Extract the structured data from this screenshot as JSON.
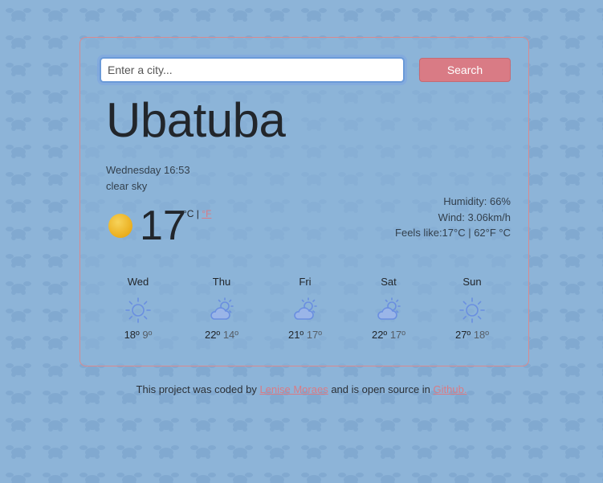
{
  "search": {
    "placeholder": "Enter a city...",
    "button_label": "Search"
  },
  "current": {
    "city": "Ubatuba",
    "datetime": "Wednesday 16:53",
    "description": "clear sky",
    "temperature": "17",
    "unit_c": "°C",
    "unit_sep": " | ",
    "unit_f": "°F",
    "icon": "sun-icon",
    "humidity": "Humidity: 66%",
    "wind": "Wind: 3.06km/h",
    "feels_like": "Feels like:17°C | 62°F °C"
  },
  "forecast": [
    {
      "day": "Wed",
      "icon": "sun-outline-icon",
      "max": "18º",
      "min": "9º"
    },
    {
      "day": "Thu",
      "icon": "cloud-sun-outline-icon",
      "max": "22º",
      "min": "14º"
    },
    {
      "day": "Fri",
      "icon": "cloud-sun-outline-icon",
      "max": "21º",
      "min": "17º"
    },
    {
      "day": "Sat",
      "icon": "cloud-sun-outline-icon",
      "max": "22º",
      "min": "17º"
    },
    {
      "day": "Sun",
      "icon": "sun-outline-icon",
      "max": "27º",
      "min": "18º"
    }
  ],
  "footer": {
    "text1": "This project was coded by ",
    "author": "Lenise Moraes",
    "text2": " and is open source in ",
    "repo": "Github."
  },
  "colors": {
    "background": "#8db4d8",
    "accent": "#d97b85",
    "icon_blue": "#6a8fe0",
    "sun_yellow": "#f2c12e"
  }
}
